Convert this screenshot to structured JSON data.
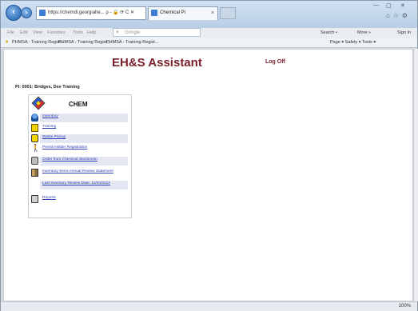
{
  "browser": {
    "address_text": "https://chemdi.georgiahe... ρ - 🔒 ⟳ C ✕",
    "tab_title": "Chemical Pi",
    "menu": [
      "File",
      "Edit",
      "View",
      "Favorites",
      "Tools",
      "Help"
    ],
    "google_label": "Google",
    "search_label": "Search •",
    "more_label": "More »",
    "signin_label": "Sign In",
    "favorites": [
      "PHMSA - Training Regist...",
      "PHMSA - Training Regist...",
      "PHMSA - Training Regist..."
    ],
    "toolbar_right": "Page ▾  Safety ▾  Tools ▾",
    "zoom": "100%"
  },
  "app": {
    "title": "EH&S Assistant",
    "logoff": "Log Off",
    "pi_line": "PI: 0001: Bridges, Dee Training"
  },
  "panel": {
    "title": "CHEM",
    "items": [
      {
        "label": "Inventory",
        "icon": "chemical-bottle-icon"
      },
      {
        "label": "Training",
        "icon": "training-cabinet-icon"
      },
      {
        "label": "Waste Pickup",
        "icon": "truck-icon"
      },
      {
        "label": "Permit Holder Registration",
        "icon": "person-icon"
      },
      {
        "label": "Order from Chemical Stockroom",
        "icon": "stockroom-icon"
      },
      {
        "label": "Inventory Semi-Annual Review Statement",
        "icon": ""
      },
      {
        "label": "Last Inventory Review Date: 11/04/2013",
        "icon": ""
      },
      {
        "label": "Reports",
        "icon": "printer-icon"
      }
    ]
  }
}
